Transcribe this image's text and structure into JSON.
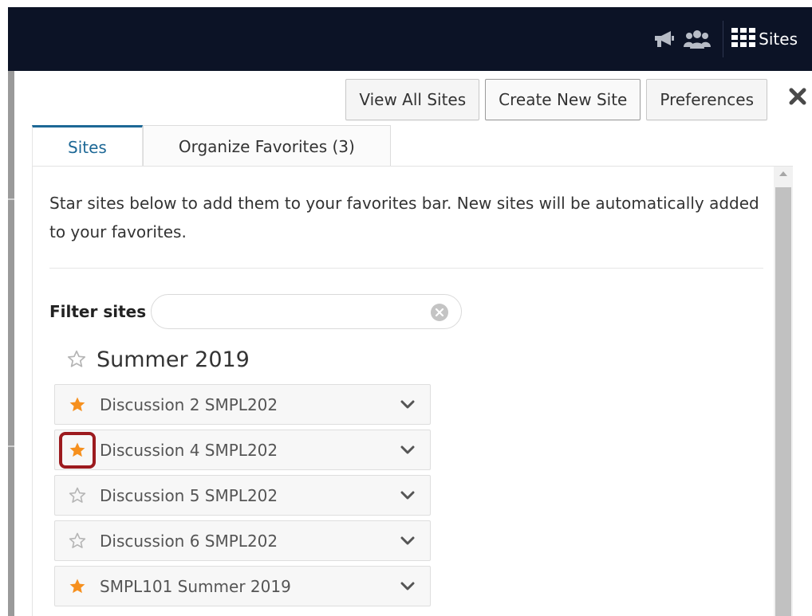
{
  "topbar": {
    "icons": [
      "megaphone-icon",
      "users-icon",
      "grid-icon"
    ],
    "sites_label": "Sites"
  },
  "toolbar": {
    "view_all_sites": "View All Sites",
    "create_new_site": "Create New Site",
    "preferences": "Preferences",
    "close_icon": "close-icon"
  },
  "tabs": [
    {
      "label": "Sites",
      "active": true
    },
    {
      "label": "Organize Favorites (3)",
      "active": false
    }
  ],
  "intro_text": "Star sites below to add them to your favorites bar. New sites will be automatically added to your favorites.",
  "filter": {
    "label": "Filter sites",
    "value": "",
    "clear_icon": "clear-icon"
  },
  "term": {
    "title": "Summer 2019",
    "starred": false
  },
  "sites": [
    {
      "label": "Discussion 2 SMPL202",
      "starred": true,
      "highlighted": false
    },
    {
      "label": "Discussion 4 SMPL202",
      "starred": true,
      "highlighted": true
    },
    {
      "label": "Discussion 5 SMPL202",
      "starred": false,
      "highlighted": false
    },
    {
      "label": "Discussion 6 SMPL202",
      "starred": false,
      "highlighted": false
    },
    {
      "label": "SMPL101 Summer 2019",
      "starred": true,
      "highlighted": false
    }
  ],
  "colors": {
    "topbar_bg": "#0c1326",
    "active_tab": "#1d6896",
    "star_filled": "#f6901e",
    "star_outline": "#b5b5b5",
    "highlight_border": "#9c1a1e"
  }
}
